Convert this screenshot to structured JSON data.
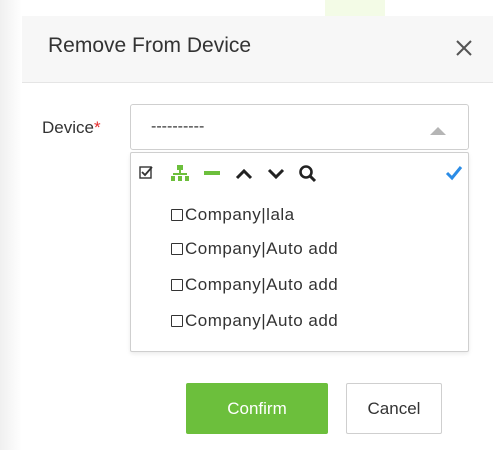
{
  "dialog": {
    "title": "Remove From Device",
    "close_icon": "close-icon"
  },
  "form": {
    "device_label": "Device",
    "required_mark": "*",
    "select_value": "----------"
  },
  "dropdown": {
    "toolbar": [
      {
        "name": "check-all-icon"
      },
      {
        "name": "tree-expand-icon"
      },
      {
        "name": "collapse-icon"
      },
      {
        "name": "chevron-up-icon"
      },
      {
        "name": "chevron-down-icon"
      },
      {
        "name": "search-icon"
      },
      {
        "name": "confirm-check-icon"
      }
    ],
    "options": [
      {
        "label": "Company|lala",
        "checked": false
      },
      {
        "label": "Company|Auto add",
        "checked": false
      },
      {
        "label": "Company|Auto add",
        "checked": false
      },
      {
        "label": "Company|Auto add",
        "checked": false
      }
    ]
  },
  "buttons": {
    "confirm": "Confirm",
    "cancel": "Cancel"
  },
  "colors": {
    "accent_green": "#6cbf3c",
    "check_blue": "#2b8ce6",
    "required_red": "#e52b2b"
  }
}
